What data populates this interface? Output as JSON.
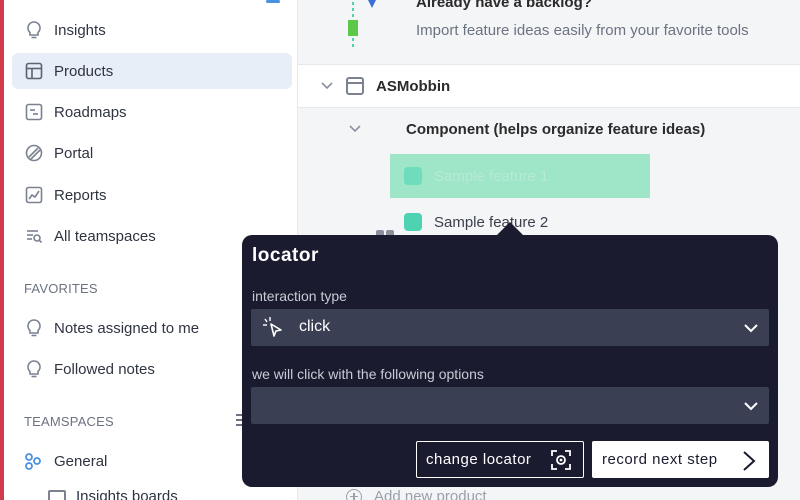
{
  "sidebar": {
    "items": [
      {
        "label": "Insights",
        "icon": "lightbulb-icon"
      },
      {
        "label": "Products",
        "icon": "layout-icon"
      },
      {
        "label": "Roadmaps",
        "icon": "roadmap-icon"
      },
      {
        "label": "Portal",
        "icon": "portal-icon"
      },
      {
        "label": "Reports",
        "icon": "chart-icon"
      },
      {
        "label": "All teamspaces",
        "icon": "list-search-icon"
      }
    ],
    "active": "Products",
    "favorites_label": "FAVORITES",
    "favorites": [
      {
        "label": "Notes assigned to me",
        "icon": "lightbulb-icon"
      },
      {
        "label": "Followed notes",
        "icon": "lightbulb-icon"
      }
    ],
    "teamspaces_label": "TEAMSPACES",
    "teamspaces": [
      {
        "label": "General",
        "icon": "teamspace-icon"
      },
      {
        "label": "Insights boards",
        "icon": "folder-icon"
      }
    ]
  },
  "main": {
    "banner": {
      "title": "Already have a backlog?",
      "subtitle": "Import feature ideas easily from your favorite tools"
    },
    "product": {
      "label": "ASMobbin"
    },
    "component": {
      "label": "Component (helps organize feature ideas)"
    },
    "features": [
      {
        "label": "Sample feature 1"
      },
      {
        "label": "Sample feature 2"
      }
    ],
    "add_product": "Add new product"
  },
  "locator": {
    "title": "locator",
    "interaction_label": "interaction type",
    "interaction_value": "click",
    "options_label": "we will click with the following options",
    "options_value": "",
    "change_button": "change locator",
    "record_button": "record next step"
  },
  "colors": {
    "accent_red": "#d13b4b",
    "active_nav": "#e7eef8",
    "feature_green": "#4dd3b2",
    "highlight_green": "#9ee6c7",
    "popup_bg": "#1a1b2e"
  }
}
